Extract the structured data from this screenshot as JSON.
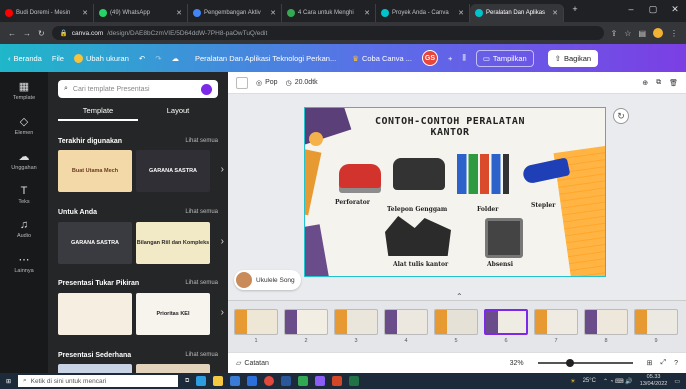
{
  "browser": {
    "tabs": [
      {
        "label": "Budi Doremi - Mesin",
        "color": "#ff0000"
      },
      {
        "label": "(49) WhatsApp",
        "color": "#25d366"
      },
      {
        "label": "Pengembangan Aktiv",
        "color": "#4285f4"
      },
      {
        "label": "4 Cara untuk Menghi",
        "color": "#34a853"
      },
      {
        "label": "Proyek Anda - Canva",
        "color": "#00c4cc"
      },
      {
        "label": "Peralatan Dan Aplikas",
        "color": "#00c4cc",
        "active": true
      }
    ],
    "url_domain": "canva.com",
    "url_path": "/design/DAE8bCzmVIE/5D64ddW-7PH8-paOwTuQ/edit"
  },
  "canva_header": {
    "home": "Beranda",
    "file": "File",
    "resize": "Ubah ukuran",
    "title": "Peralatan Dan Aplikasi Teknologi Perkan...",
    "try_canva": "Coba Canva ...",
    "avatar": "GS",
    "present": "Tampilkan",
    "share": "Bagikan"
  },
  "rail": [
    {
      "label": "Template",
      "icon": "template-icon"
    },
    {
      "label": "Elemen",
      "icon": "elements-icon"
    },
    {
      "label": "Unggahan",
      "icon": "upload-icon"
    },
    {
      "label": "Teks",
      "icon": "text-icon"
    },
    {
      "label": "Audio",
      "icon": "audio-icon"
    },
    {
      "label": "Lainnya",
      "icon": "more-icon"
    }
  ],
  "panel": {
    "search_placeholder": "Cari template Presentasi",
    "tab_template": "Template",
    "tab_layout": "Layout",
    "sections": [
      {
        "title": "Terakhir digunakan",
        "see_all": "Lihat semua"
      },
      {
        "title": "Untuk Anda",
        "see_all": "Lihat semua"
      },
      {
        "title": "Presentasi Tukar Pikiran",
        "see_all": "Lihat semua"
      },
      {
        "title": "Presentasi Sederhana",
        "see_all": "Lihat semua"
      }
    ],
    "thumbs": [
      "Buat Utama Mech",
      "GARANA SASTRA",
      "GARANA SASTRA",
      "Bilangan Riil dan Kompleks",
      "",
      "Prioritas KEI"
    ]
  },
  "toolbar": {
    "animate": "Pop",
    "duration": "20.0dtk"
  },
  "slide": {
    "title_line1": "CONTOH-CONTOH PERALATAN",
    "title_line2": "KANTOR",
    "labels": [
      "Perforator",
      "Telepon Genggam",
      "Folder",
      "Stepler",
      "Alat tulis kantor",
      "Absensi"
    ]
  },
  "user_chip": "Ukulele Song",
  "pages": [
    "1",
    "2",
    "3",
    "4",
    "5",
    "6",
    "7",
    "8",
    "9"
  ],
  "selected_page": 6,
  "bottom": {
    "notes": "Catatan",
    "zoom": "32%"
  },
  "taskbar": {
    "search": "Ketik di sini untuk mencari",
    "weather": "25°C",
    "time": "05.33",
    "date": "13/04/2022"
  }
}
